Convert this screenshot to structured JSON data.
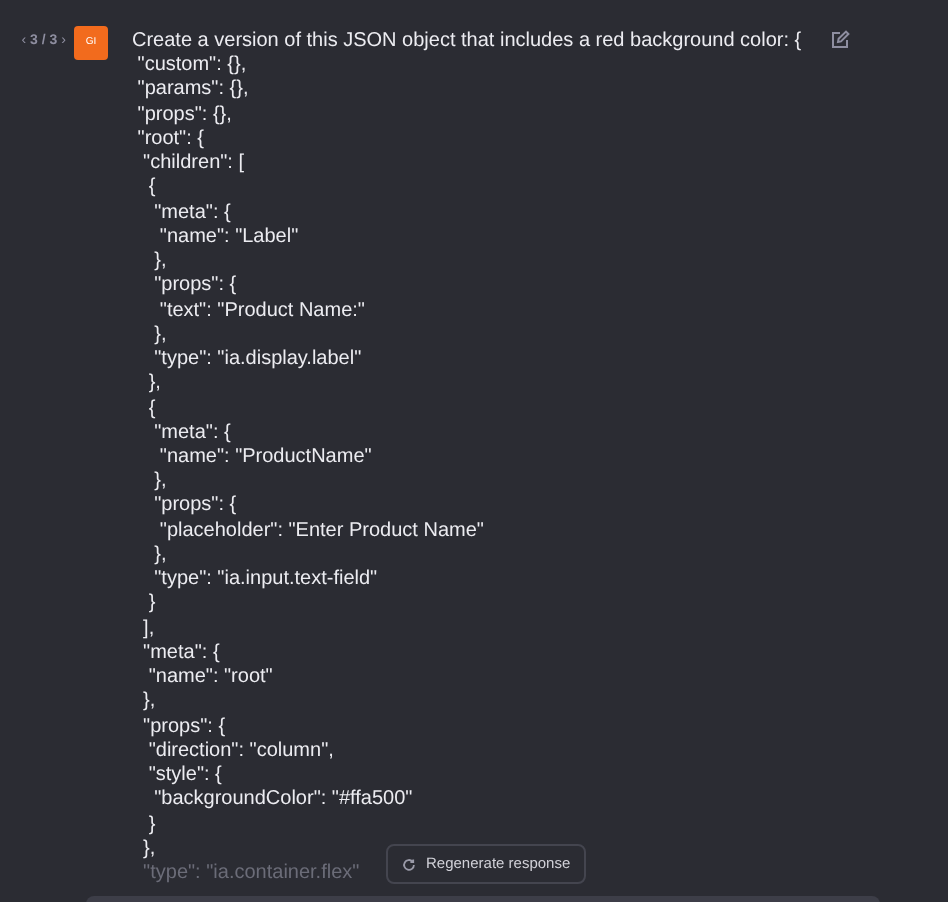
{
  "message": {
    "pager": {
      "prev": "‹",
      "label": "3 / 3",
      "next": "›"
    },
    "avatar": "GI",
    "lines": [
      {
        "text": "Create a version of this JSON object that includes a red background color: {",
        "faded": false
      },
      {
        "text": " \"custom\": {},",
        "faded": false
      },
      {
        "text": " \"params\": {},",
        "faded": false
      },
      {
        "text": " \"props\": {},",
        "faded": false
      },
      {
        "text": " \"root\": {",
        "faded": false
      },
      {
        "text": "  \"children\": [",
        "faded": false
      },
      {
        "text": "   {",
        "faded": false
      },
      {
        "text": "    \"meta\": {",
        "faded": false
      },
      {
        "text": "     \"name\": \"Label\"",
        "faded": false
      },
      {
        "text": "    },",
        "faded": false
      },
      {
        "text": "    \"props\": {",
        "faded": false
      },
      {
        "text": "     \"text\": \"Product Name:\"",
        "faded": false
      },
      {
        "text": "    },",
        "faded": false
      },
      {
        "text": "    \"type\": \"ia.display.label\"",
        "faded": false
      },
      {
        "text": "   },",
        "faded": false
      },
      {
        "text": "   {",
        "faded": false
      },
      {
        "text": "    \"meta\": {",
        "faded": false
      },
      {
        "text": "     \"name\": \"ProductName\"",
        "faded": false
      },
      {
        "text": "    },",
        "faded": false
      },
      {
        "text": "    \"props\": {",
        "faded": false
      },
      {
        "text": "     \"placeholder\": \"Enter Product Name\"",
        "faded": false
      },
      {
        "text": "    },",
        "faded": false
      },
      {
        "text": "    \"type\": \"ia.input.text-field\"",
        "faded": false
      },
      {
        "text": "   }",
        "faded": false
      },
      {
        "text": "  ],",
        "faded": false
      },
      {
        "text": "  \"meta\": {",
        "faded": false
      },
      {
        "text": "   \"name\": \"root\"",
        "faded": false
      },
      {
        "text": "  },",
        "faded": false
      },
      {
        "text": "  \"props\": {",
        "faded": false
      },
      {
        "text": "   \"direction\": \"column\",",
        "faded": false
      },
      {
        "text": "   \"style\": {",
        "faded": false
      },
      {
        "text": "    \"backgroundColor\": \"#ffa500\"",
        "faded": false
      },
      {
        "text": "   }",
        "faded": false
      },
      {
        "text": "  },",
        "faded": false
      },
      {
        "text": "  \"type\": \"ia.container.flex\"",
        "faded": true
      }
    ]
  },
  "regenerate_button": "Regenerate response"
}
